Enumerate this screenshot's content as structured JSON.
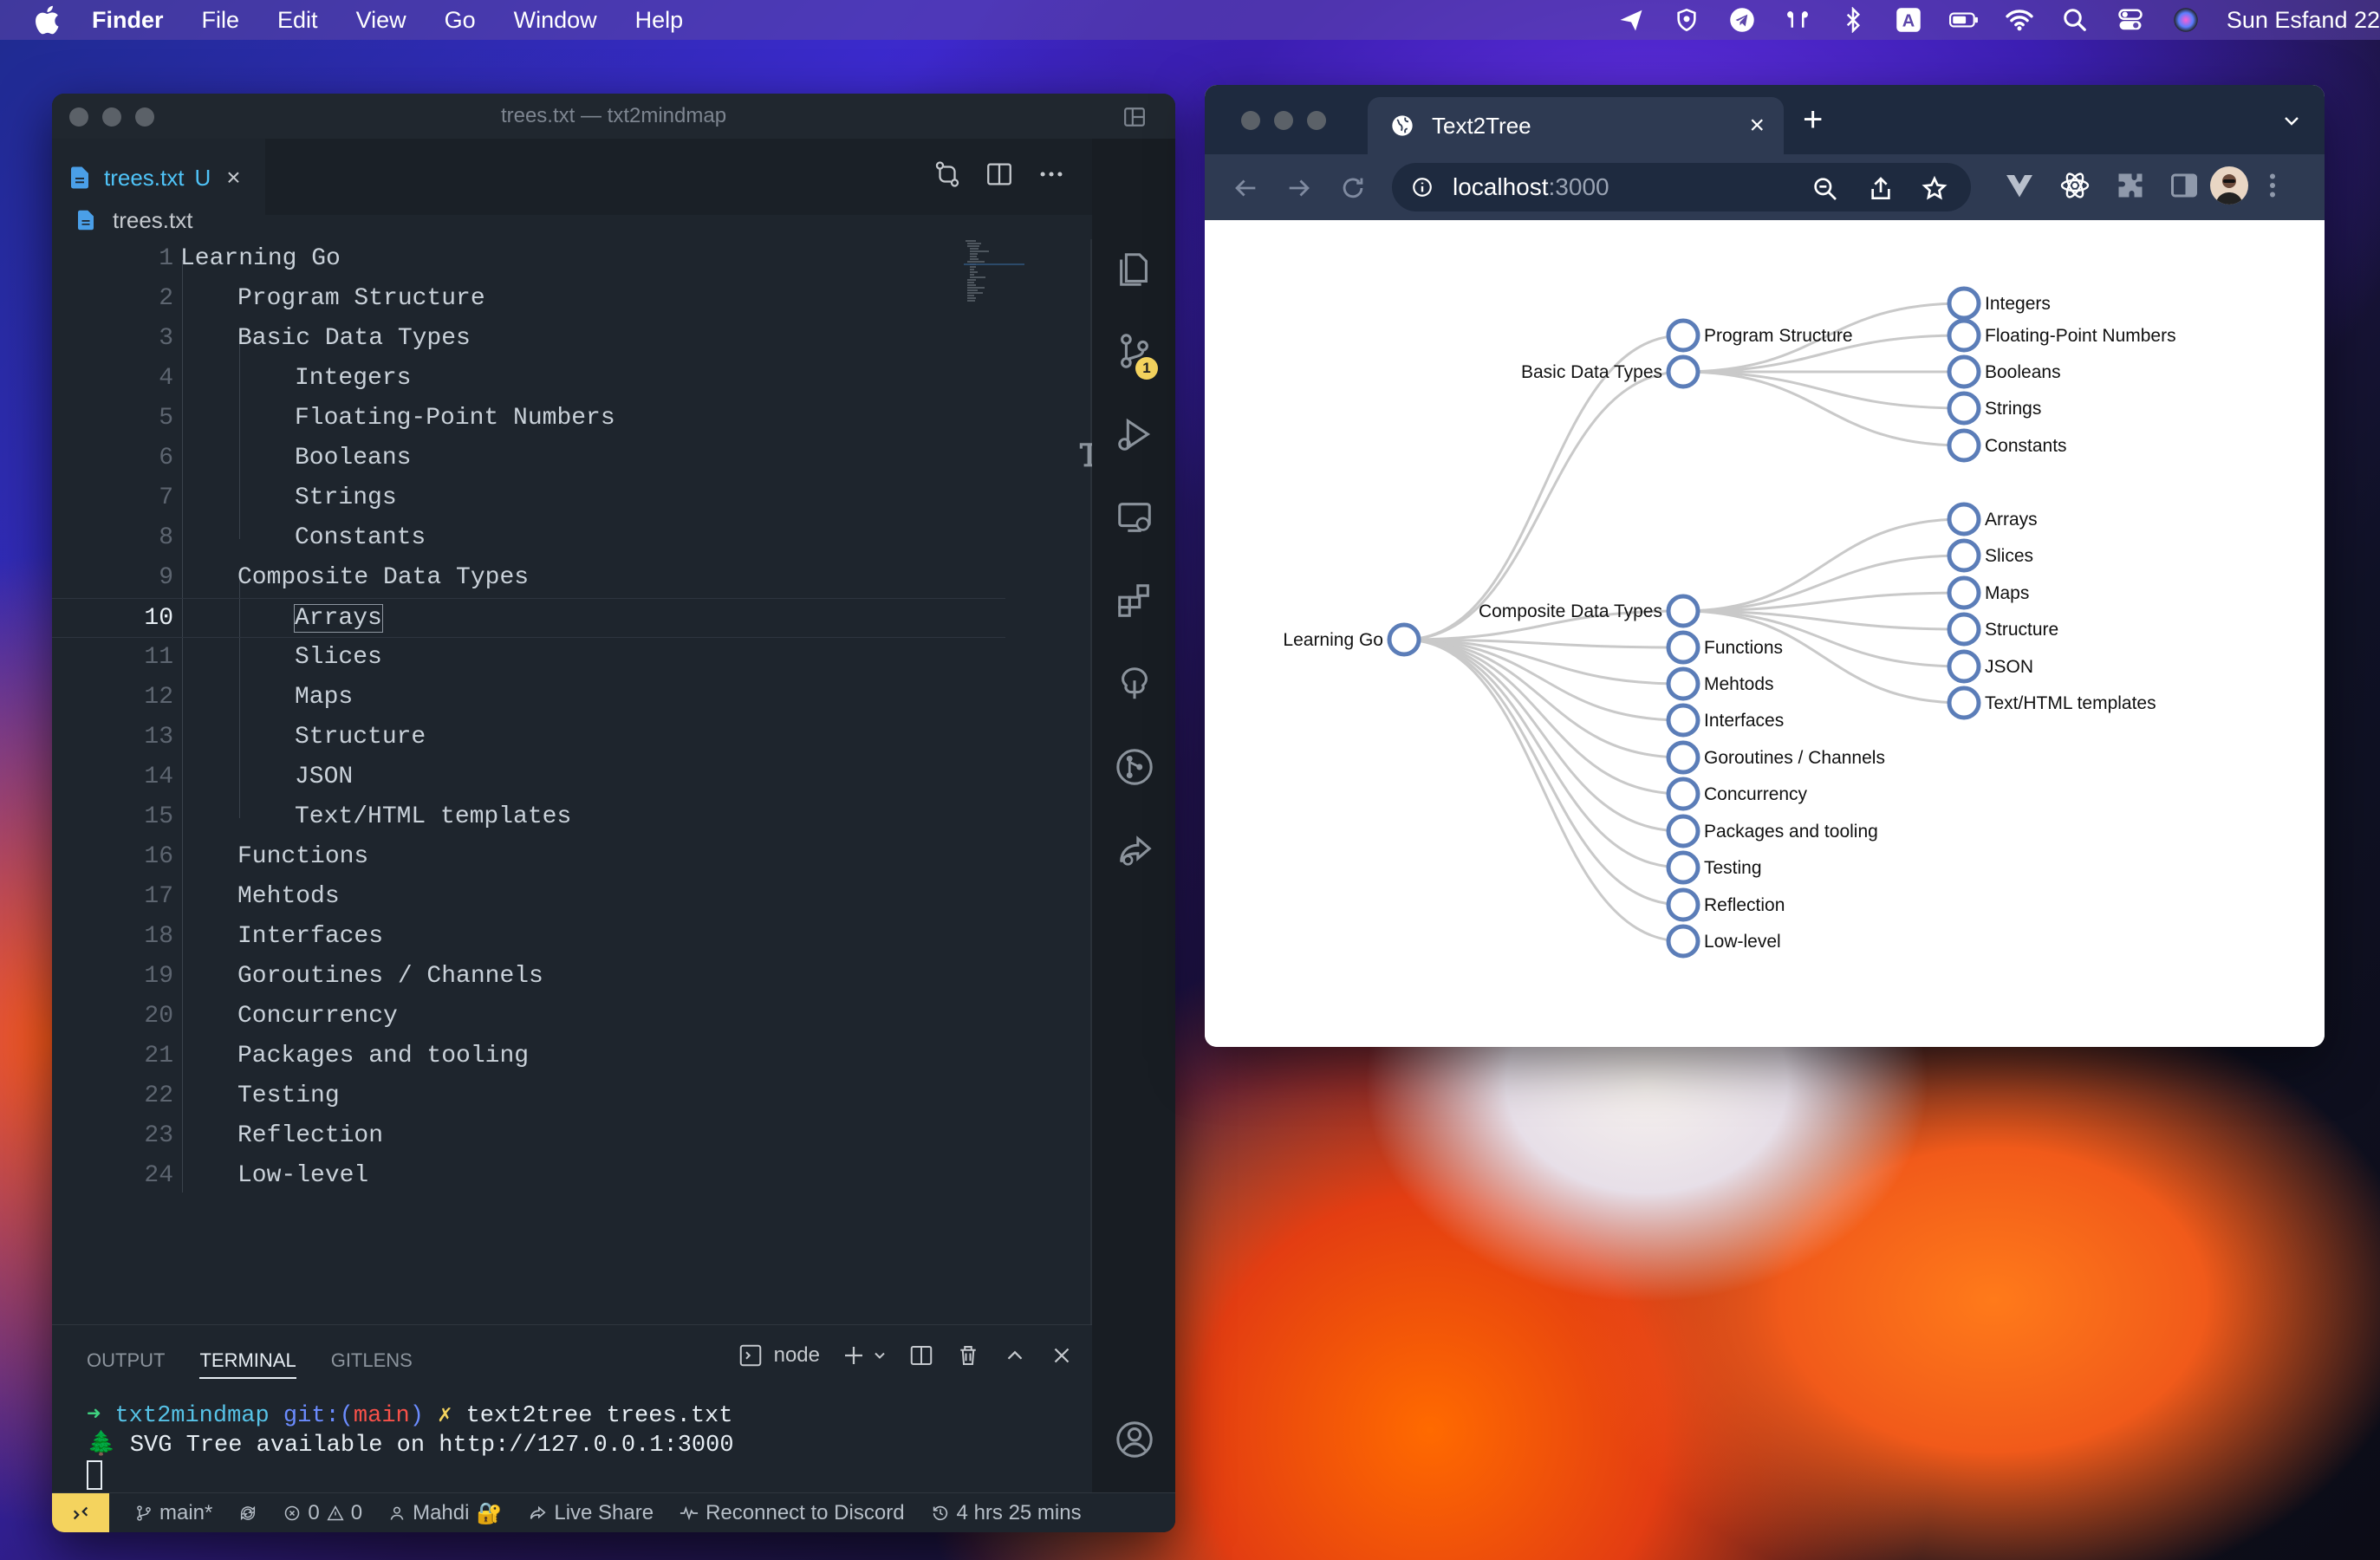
{
  "menubar": {
    "app": "Finder",
    "items": [
      "File",
      "Edit",
      "View",
      "Go",
      "Window",
      "Help"
    ],
    "clock": "Sun Esfand 22"
  },
  "vscode": {
    "title": "trees.txt — txt2mindmap",
    "tab": {
      "name": "trees.txt",
      "state": "U"
    },
    "breadcrumb": "trees.txt",
    "lines": [
      {
        "n": "1",
        "indent": 0,
        "text": "Learning Go"
      },
      {
        "n": "2",
        "indent": 1,
        "text": "Program Structure"
      },
      {
        "n": "3",
        "indent": 1,
        "text": "Basic Data Types"
      },
      {
        "n": "4",
        "indent": 2,
        "text": "Integers"
      },
      {
        "n": "5",
        "indent": 2,
        "text": "Floating-Point Numbers"
      },
      {
        "n": "6",
        "indent": 2,
        "text": "Booleans"
      },
      {
        "n": "7",
        "indent": 2,
        "text": "Strings"
      },
      {
        "n": "8",
        "indent": 2,
        "text": "Constants"
      },
      {
        "n": "9",
        "indent": 1,
        "text": "Composite Data Types"
      },
      {
        "n": "10",
        "indent": 2,
        "text": "Arrays",
        "current": true
      },
      {
        "n": "11",
        "indent": 2,
        "text": "Slices"
      },
      {
        "n": "12",
        "indent": 2,
        "text": "Maps"
      },
      {
        "n": "13",
        "indent": 2,
        "text": "Structure"
      },
      {
        "n": "14",
        "indent": 2,
        "text": "JSON"
      },
      {
        "n": "15",
        "indent": 2,
        "text": "Text/HTML templates"
      },
      {
        "n": "16",
        "indent": 1,
        "text": "Functions"
      },
      {
        "n": "17",
        "indent": 1,
        "text": "Mehtods"
      },
      {
        "n": "18",
        "indent": 1,
        "text": "Interfaces"
      },
      {
        "n": "19",
        "indent": 1,
        "text": "Goroutines / Channels"
      },
      {
        "n": "20",
        "indent": 1,
        "text": "Concurrency"
      },
      {
        "n": "21",
        "indent": 1,
        "text": "Packages and tooling"
      },
      {
        "n": "22",
        "indent": 1,
        "text": "Testing"
      },
      {
        "n": "23",
        "indent": 1,
        "text": "Reflection"
      },
      {
        "n": "24",
        "indent": 1,
        "text": "Low-level"
      }
    ],
    "source_control_badge": "1",
    "panel": {
      "tabs": [
        "OUTPUT",
        "TERMINAL",
        "GITLENS"
      ],
      "active_tab": "TERMINAL",
      "shell": "node",
      "terminal": {
        "prompt_arrow": "➜",
        "dir": "txt2mindmap",
        "git_label": "git:(",
        "branch": "main",
        "git_close": ")",
        "dirty": "✗",
        "command": "text2tree trees.txt",
        "output_icon": "🌲",
        "output": "SVG Tree available on http://127.0.0.1:3000"
      }
    },
    "status": {
      "remote_icon": "remote-icon",
      "branch": "main*",
      "errors": "0",
      "warnings": "0",
      "user": "Mahdi",
      "user_emoji": "🔐",
      "live_share": "Live Share",
      "discord": "Reconnect to Discord",
      "time": "4 hrs 25 mins"
    }
  },
  "browser": {
    "tab_title": "Text2Tree",
    "url_host": "localhost",
    "url_port": ":3000"
  },
  "tree": {
    "root": "Learning Go",
    "children": [
      {
        "label": "Program Structure",
        "children": []
      },
      {
        "label": "Basic Data Types",
        "children": [
          "Integers",
          "Floating-Point Numbers",
          "Booleans",
          "Strings",
          "Constants"
        ]
      },
      {
        "label": "Composite Data Types",
        "children": [
          "Arrays",
          "Slices",
          "Maps",
          "Structure",
          "JSON",
          "Text/HTML templates"
        ]
      },
      {
        "label": "Functions",
        "children": []
      },
      {
        "label": "Mehtods",
        "children": []
      },
      {
        "label": "Interfaces",
        "children": []
      },
      {
        "label": "Goroutines / Channels",
        "children": []
      },
      {
        "label": "Concurrency",
        "children": []
      },
      {
        "label": "Packages and tooling",
        "children": []
      },
      {
        "label": "Testing",
        "children": []
      },
      {
        "label": "Reflection",
        "children": []
      },
      {
        "label": "Low-level",
        "children": []
      }
    ],
    "colors": {
      "node_stroke": "#5b7db8",
      "link": "#c9c9c9"
    }
  }
}
